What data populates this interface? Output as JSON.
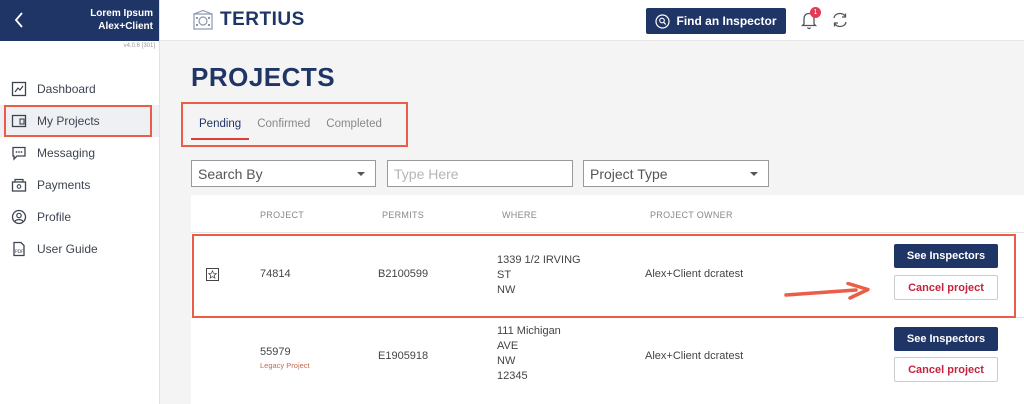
{
  "sidebar": {
    "user_name": "Lorem Ipsum",
    "user_role": "Alex+Client",
    "version": "v4.0.6 [301]",
    "items": [
      {
        "label": "Dashboard",
        "icon": "dashboard-icon"
      },
      {
        "label": "My Projects",
        "icon": "projects-icon",
        "active": true
      },
      {
        "label": "Messaging",
        "icon": "chat-icon"
      },
      {
        "label": "Payments",
        "icon": "payments-icon"
      },
      {
        "label": "Profile",
        "icon": "profile-icon"
      },
      {
        "label": "User Guide",
        "icon": "pdf-icon"
      }
    ]
  },
  "header": {
    "brand": "TERTIUS",
    "find_inspector_label": "Find an Inspector",
    "notification_count": "1"
  },
  "page": {
    "title": "PROJECTS",
    "tabs": [
      {
        "label": "Pending",
        "active": true
      },
      {
        "label": "Confirmed"
      },
      {
        "label": "Completed"
      }
    ]
  },
  "filters": {
    "search_by": "Search By",
    "type_here_placeholder": "Type Here",
    "project_type": "Project Type"
  },
  "table": {
    "columns": [
      "PROJECT",
      "PERMITS",
      "WHERE",
      "PROJECT OWNER"
    ],
    "rows": [
      {
        "project": "74814",
        "permit": "B2100599",
        "where": [
          "1339 1/2 IRVING",
          "ST",
          "NW"
        ],
        "owner": "Alex+Client dcratest",
        "see_label": "See Inspectors",
        "cancel_label": "Cancel project"
      },
      {
        "project": "55979",
        "tag": "Legacy Project",
        "permit": "E1905918",
        "where": [
          "111 Michigan",
          "AVE",
          "NW",
          "12345"
        ],
        "owner": "Alex+Client dcratest",
        "see_label": "See Inspectors",
        "cancel_label": "Cancel project"
      }
    ]
  },
  "colors": {
    "brand": "#1f3566",
    "highlight": "#ea5e47",
    "danger": "#c5243c"
  }
}
